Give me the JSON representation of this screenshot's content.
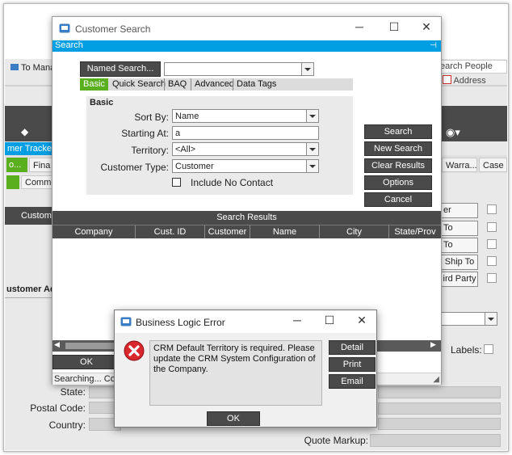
{
  "background": {
    "toolbar_left_text": "To Mana",
    "search_people": "earch People",
    "address_book": "Address Book",
    "tracker_tab": "mer Tracke",
    "tab_o": "o...",
    "tab_finan": "Fina",
    "tab_warra": "Warra...",
    "tab_case": "Case",
    "tab_comme": "Comme",
    "customer_tab": "Custome",
    "side_buttons": [
      "er",
      "To",
      "To",
      "Ship To",
      "ird Party"
    ],
    "customer_address": "ustomer Ad",
    "labels_label": "Labels:",
    "state_label": "State:",
    "postal_code_label": "Postal Code:",
    "country_label": "Country:",
    "quote_markup_label": "Quote Markup:"
  },
  "customer_search": {
    "title": "Customer Search",
    "panel_bar": "Search",
    "named_search_button": "Named Search...",
    "named_search_value": "",
    "tabs": [
      {
        "label": "Basic",
        "active": true
      },
      {
        "label": "Quick Search",
        "active": false
      },
      {
        "label": "BAQ",
        "active": false
      },
      {
        "label": "Advanced",
        "active": false
      },
      {
        "label": "Data Tags",
        "active": false
      }
    ],
    "group_title": "Basic",
    "sort_by_label": "Sort By:",
    "sort_by_value": "Name",
    "starting_at_label": "Starting At:",
    "starting_at_value": "a",
    "territory_label": "Territory:",
    "territory_value": "<All>",
    "customer_type_label": "Customer Type:",
    "customer_type_value": "Customer",
    "include_no_contact_label": "Include No Contact",
    "buttons": {
      "search": "Search",
      "new_search": "New Search",
      "clear_results": "Clear Results",
      "options": "Options",
      "cancel": "Cancel"
    },
    "results_title": "Search Results",
    "columns": [
      "Company",
      "Cust. ID",
      "Customer",
      "Name",
      "City",
      "State/Prov"
    ],
    "ok_button": "OK",
    "status_text": "Searching... Com"
  },
  "error_dialog": {
    "title": "Business Logic Error",
    "message": "CRM Default Territory is required.  Please update the CRM System Configuration of the Company.",
    "buttons": {
      "detail": "Detail",
      "print": "Print",
      "email": "Email",
      "ok": "OK"
    }
  },
  "colors": {
    "accent_blue": "#009ee3",
    "tab_green": "#5aaf1e",
    "dark_gray": "#4a4a4a",
    "error_red": "#d9272e"
  }
}
